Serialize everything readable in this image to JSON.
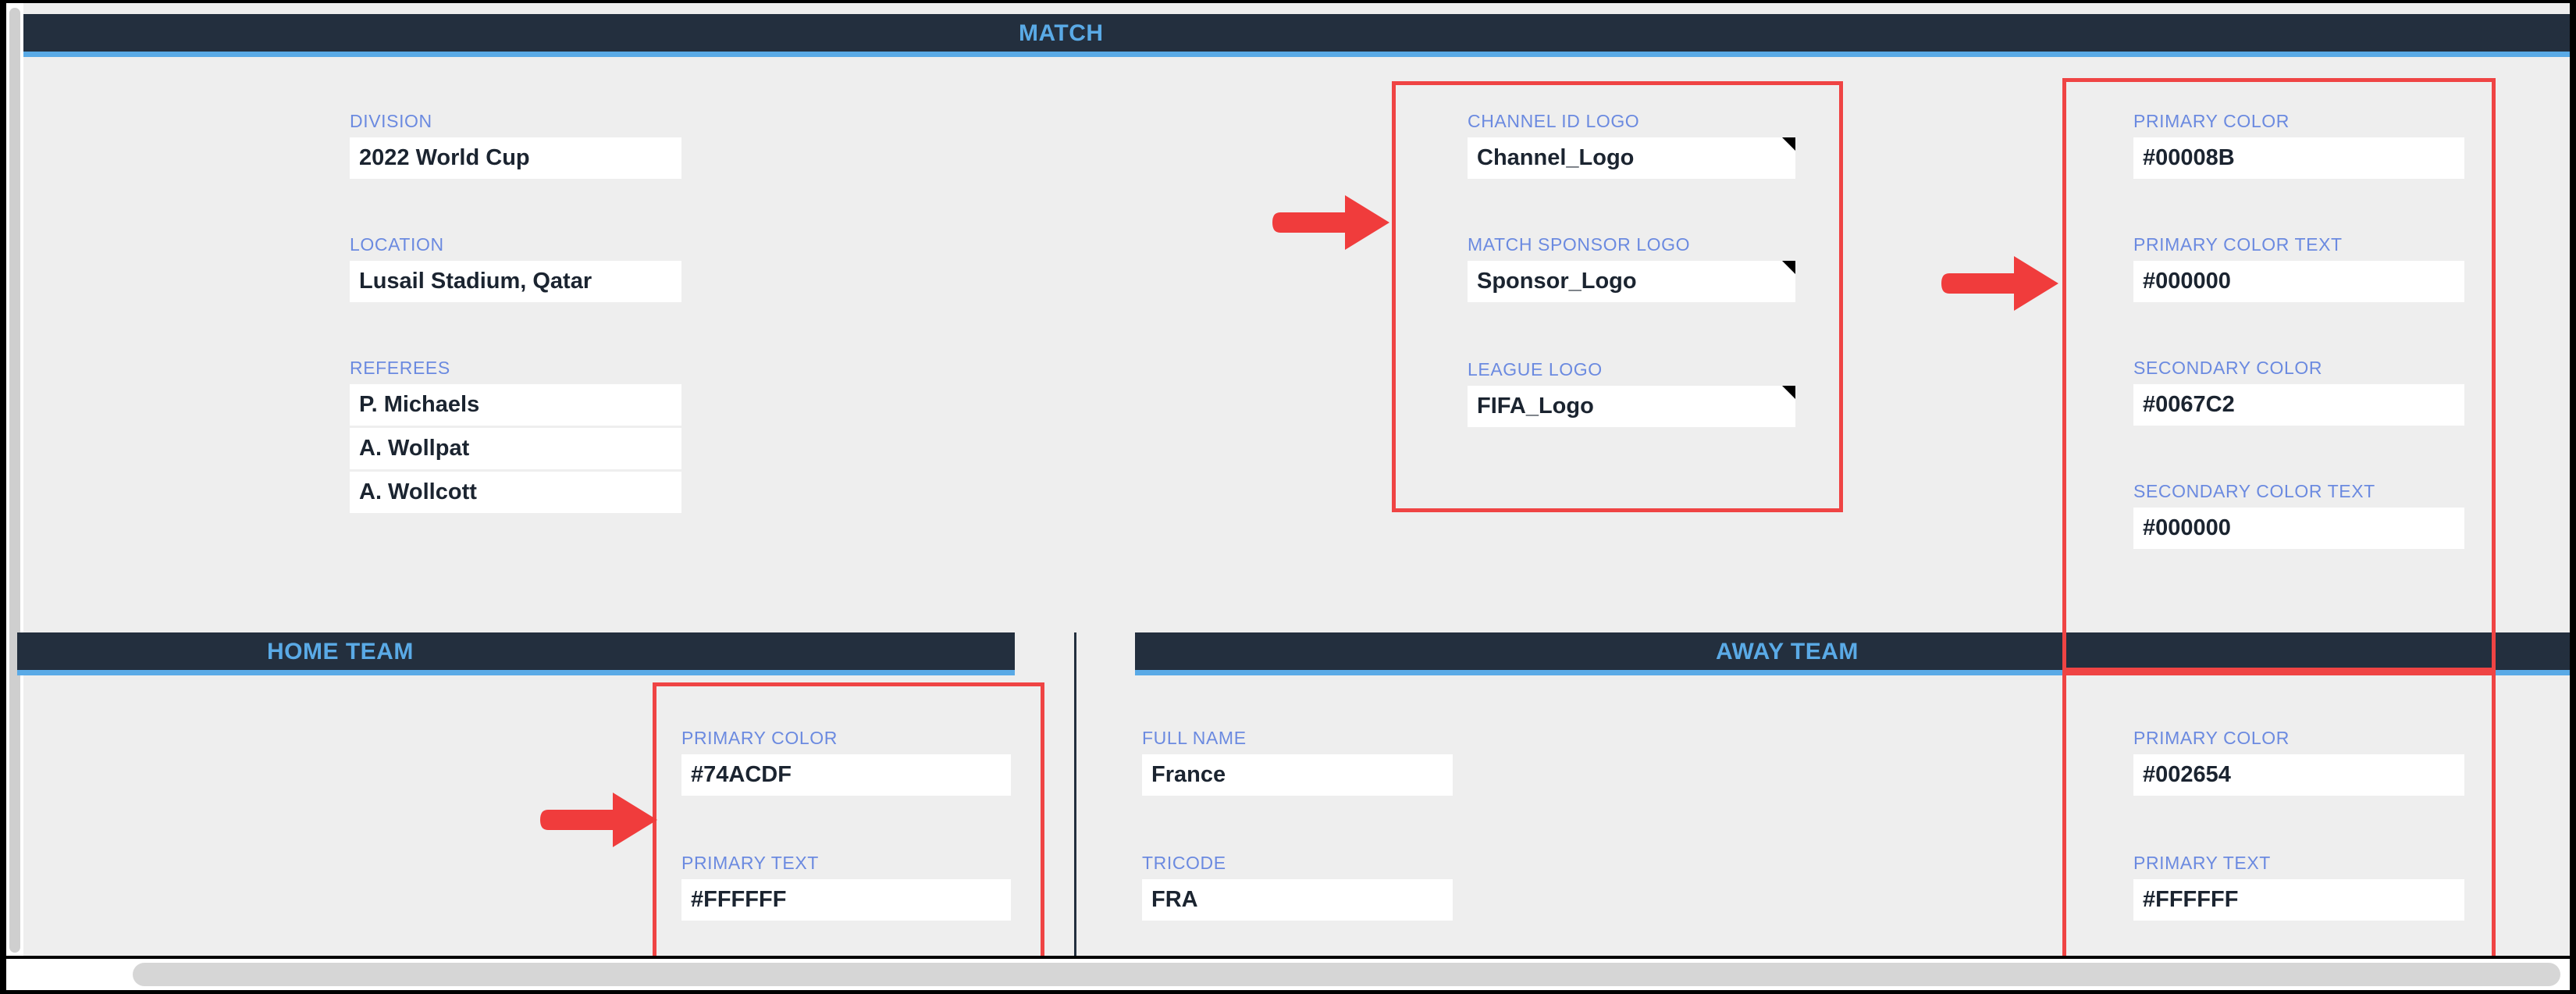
{
  "app": {
    "background_color": "#eeeeee",
    "header_bar_color": "#232f3e",
    "header_text_color": "#5aaae6",
    "label_color": "#6b8ae0",
    "annotation_color": "#ef4444"
  },
  "sections": {
    "match": {
      "title": "MATCH",
      "fields": {
        "division": {
          "label": "DIVISION",
          "value": "2022 World Cup"
        },
        "location": {
          "label": "LOCATION",
          "value": "Lusail Stadium, Qatar"
        },
        "referees": {
          "label": "REFEREES",
          "values": [
            "P. Michaels",
            "A. Wollpat",
            "A. Wollcott"
          ]
        },
        "channel_id_logo": {
          "label": "CHANNEL ID LOGO",
          "value": "Channel_Logo"
        },
        "match_sponsor_logo": {
          "label": "MATCH SPONSOR LOGO",
          "value": "Sponsor_Logo"
        },
        "league_logo": {
          "label": "LEAGUE LOGO",
          "value": "FIFA_Logo"
        },
        "primary_color": {
          "label": "PRIMARY COLOR",
          "value": "#00008B"
        },
        "primary_color_text": {
          "label": "PRIMARY COLOR TEXT",
          "value": "#000000"
        },
        "secondary_color": {
          "label": "SECONDARY COLOR",
          "value": "#0067C2"
        },
        "secondary_color_text": {
          "label": "SECONDARY COLOR TEXT",
          "value": "#000000"
        }
      }
    },
    "home_team": {
      "title": "HOME TEAM",
      "fields": {
        "primary_color": {
          "label": "PRIMARY COLOR",
          "value": "#74ACDF"
        },
        "primary_text": {
          "label": "PRIMARY TEXT",
          "value": "#FFFFFF"
        }
      }
    },
    "away_team": {
      "title": "AWAY TEAM",
      "fields": {
        "full_name": {
          "label": "FULL NAME",
          "value": "France"
        },
        "tricode": {
          "label": "TRICODE",
          "value": "FRA"
        },
        "primary_color": {
          "label": "PRIMARY COLOR",
          "value": "#002654"
        },
        "primary_text": {
          "label": "PRIMARY TEXT",
          "value": "#FFFFFF"
        }
      }
    }
  },
  "annotations": {
    "boxes": [
      {
        "name": "logos-highlight"
      },
      {
        "name": "match-colors-highlight"
      },
      {
        "name": "home-colors-highlight"
      },
      {
        "name": "away-colors-highlight"
      }
    ],
    "arrows": [
      {
        "name": "arrow-to-logos"
      },
      {
        "name": "arrow-to-match-colors"
      },
      {
        "name": "arrow-to-home-colors"
      }
    ]
  }
}
